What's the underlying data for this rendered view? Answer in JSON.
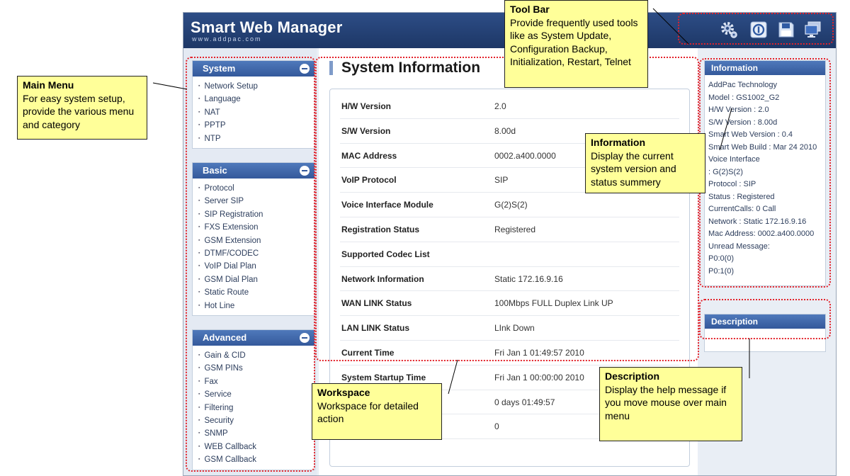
{
  "app": {
    "title": "Smart Web Manager",
    "subtitle": "www.addpac.com"
  },
  "toolbar": {
    "icons": [
      "gear-icon",
      "info-power-icon",
      "save-disk-icon",
      "monitor-icon"
    ]
  },
  "menu": {
    "sections": [
      {
        "title": "System",
        "items": [
          "Network Setup",
          "Language",
          "NAT",
          "PPTP",
          "NTP"
        ]
      },
      {
        "title": "Basic",
        "items": [
          "Protocol",
          "Server SIP",
          "SIP Registration",
          "FXS Extension",
          "GSM Extension",
          "DTMF/CODEC",
          "VoIP Dial Plan",
          "GSM Dial Plan",
          "Static Route",
          "Hot Line"
        ]
      },
      {
        "title": "Advanced",
        "items": [
          "Gain & CID",
          "GSM PINs",
          "Fax",
          "Service",
          "Filtering",
          "Security",
          "SNMP",
          "WEB Callback",
          "GSM Callback"
        ]
      }
    ]
  },
  "workspace": {
    "title": "System Information",
    "rows": [
      {
        "label": "H/W Version",
        "value": "2.0"
      },
      {
        "label": "S/W Version",
        "value": "8.00d"
      },
      {
        "label": "MAC Address",
        "value": "0002.a400.0000"
      },
      {
        "label": "VoIP Protocol",
        "value": "SIP"
      },
      {
        "label": "Voice Interface Module",
        "value": "G(2)S(2)"
      },
      {
        "label": "Registration Status",
        "value": "Registered"
      },
      {
        "label": "Supported Codec List",
        "value": ""
      },
      {
        "label": "Network Information",
        "value": "Static 172.16.9.16"
      },
      {
        "label": "WAN LINK Status",
        "value": "100Mbps FULL Duplex Link UP"
      },
      {
        "label": "LAN LINK Status",
        "value": "LInk Down"
      },
      {
        "label": "Current Time",
        "value": "Fri Jan 1 01:49:57 2010"
      },
      {
        "label": "System Startup Time",
        "value": "Fri Jan 1 00:00:00 2010"
      },
      {
        "label": "",
        "value": "0 days 01:49:57"
      },
      {
        "label": "",
        "value": "0"
      }
    ]
  },
  "information": {
    "title": "Information",
    "lines": [
      "AddPac Technology",
      "Model : GS1002_G2",
      "H/W Version : 2.0",
      "S/W Version : 8.00d",
      "Smart Web Version : 0.4",
      "Smart Web Build : Mar 24 2010",
      "Voice Interface",
      ": G(2)S(2)",
      "Protocol : SIP",
      "Status : Registered",
      "CurrentCalls: 0 Call",
      "Network : Static 172.16.9.16",
      "Mac Address: 0002.a400.0000",
      "Unread Message:",
      "P0:0(0)",
      "P0:1(0)"
    ]
  },
  "description": {
    "title": "Description"
  },
  "callouts": {
    "main_menu": {
      "title": "Main Menu",
      "body": "For easy system setup, provide the various menu and category"
    },
    "tool_bar": {
      "title": "Tool Bar",
      "body": "Provide frequently used tools like as System Update, Configuration Backup, Initialization, Restart, Telnet"
    },
    "information": {
      "title": "Information",
      "body": "Display the current system version and status summery"
    },
    "workspace": {
      "title": "Workspace",
      "body": "Workspace for detailed action"
    },
    "description": {
      "title": "Description",
      "body": "Display the help message if you move mouse over main menu"
    }
  },
  "colors": {
    "header": "#1d3766",
    "menu_header": "#34599b",
    "annotation_border": "#e3232b",
    "callout_fill": "#ffff99"
  }
}
